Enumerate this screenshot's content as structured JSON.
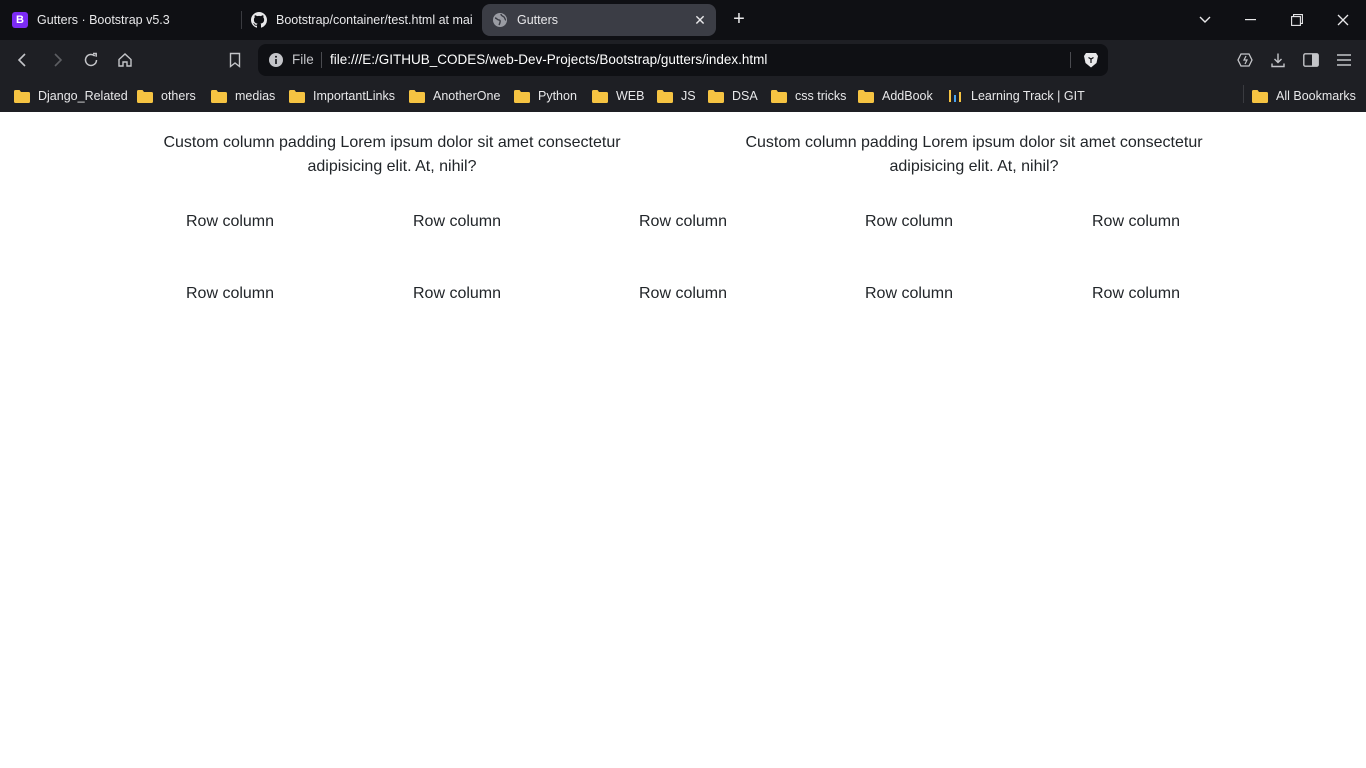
{
  "browser": {
    "tabs": [
      {
        "title": "Gutters · Bootstrap v5.3",
        "icon": "bootstrap-logo-icon",
        "active": false
      },
      {
        "title": "Bootstrap/container/test.html at mai",
        "icon": "github-icon",
        "active": false
      },
      {
        "title": "Gutters",
        "icon": "globe-icon",
        "active": true
      }
    ],
    "address": {
      "scheme": "File",
      "url": "file:///E:/GITHUB_CODES/web-Dev-Projects/Bootstrap/gutters/index.html"
    },
    "bookmarks": [
      "Django_Related",
      "others",
      "medias",
      "ImportantLinks",
      "AnotherOne",
      "Python",
      "WEB",
      "JS",
      "DSA",
      "css tricks",
      "AddBook",
      "Learning Track | GIT"
    ],
    "all_bookmarks": "All Bookmarks",
    "colors": {
      "tab_strip": "#0f1014",
      "toolbar": "#1e1f24",
      "active_tab": "#3b3d45",
      "folder": "#f5c342",
      "bootstrap": "#7c2bf5"
    }
  },
  "page": {
    "custom_columns": [
      "Custom column padding Lorem ipsum dolor sit amet consectetur adipisicing elit. At, nihil?",
      "Custom column padding Lorem ipsum dolor sit amet consectetur adipisicing elit. At, nihil?"
    ],
    "row_label": "Row column",
    "rows": [
      [
        "Row column",
        "Row column",
        "Row column",
        "Row column",
        "Row column"
      ],
      [
        "Row column",
        "Row column",
        "Row column",
        "Row column",
        "Row column"
      ]
    ]
  }
}
